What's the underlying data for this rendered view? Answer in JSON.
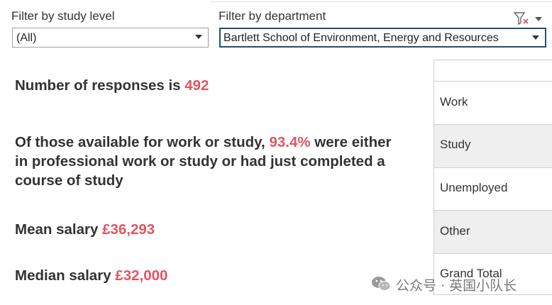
{
  "filters": {
    "study_level": {
      "label": "Filter by study level",
      "value": "(All)"
    },
    "department": {
      "label": "Filter by department",
      "value": "Bartlett School of Environment, Energy and Resources"
    }
  },
  "stats": {
    "responses": {
      "prefix": "Number of responses is ",
      "value": "492"
    },
    "available": {
      "prefix": "Of those available for work or study, ",
      "value": "93.4%",
      "suffix": " were either in professional work or study or had just completed a course of study"
    },
    "mean_salary": {
      "prefix": "Mean salary ",
      "value": "£36,293"
    },
    "median_salary": {
      "prefix": "Median salary ",
      "value": "£32,000"
    }
  },
  "table": {
    "rows": [
      "Work",
      "Study",
      "Unemployed",
      "Other",
      "Grand Total"
    ]
  },
  "watermark": {
    "text": "公众号 · 英国小队长"
  },
  "colors": {
    "highlight": "#e05561",
    "active_border": "#1f4e79",
    "row_shade": "#efefef"
  }
}
